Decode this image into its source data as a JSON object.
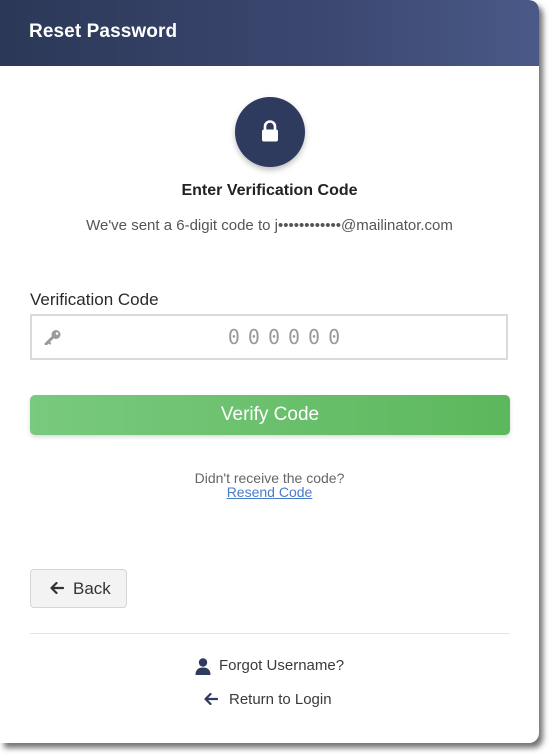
{
  "header": {
    "title": "Reset Password",
    "gradient_start": "#2c3857",
    "gradient_end": "#4a5987"
  },
  "hero": {
    "icon": "lock-icon",
    "subtitle": "Enter Verification Code",
    "message": "We've sent a 6-digit code to j••••••••••••@mailinator.com"
  },
  "form": {
    "label": "Verification Code",
    "field_icon": "key-icon",
    "value": "",
    "placeholder": "000000",
    "submit_label": "Verify Code",
    "submit_color": "#5cb85c"
  },
  "resend": {
    "question": "Didn't receive the code?",
    "link_label": "Resend Code",
    "link_color": "#4a7cc9"
  },
  "back_button": {
    "icon": "arrow-left-icon",
    "label": "Back"
  },
  "footer_links": {
    "forgot_username": {
      "icon": "user-icon",
      "label": "Forgot Username?"
    },
    "return_login": {
      "icon": "arrow-left-icon",
      "label": "Return to Login"
    }
  }
}
